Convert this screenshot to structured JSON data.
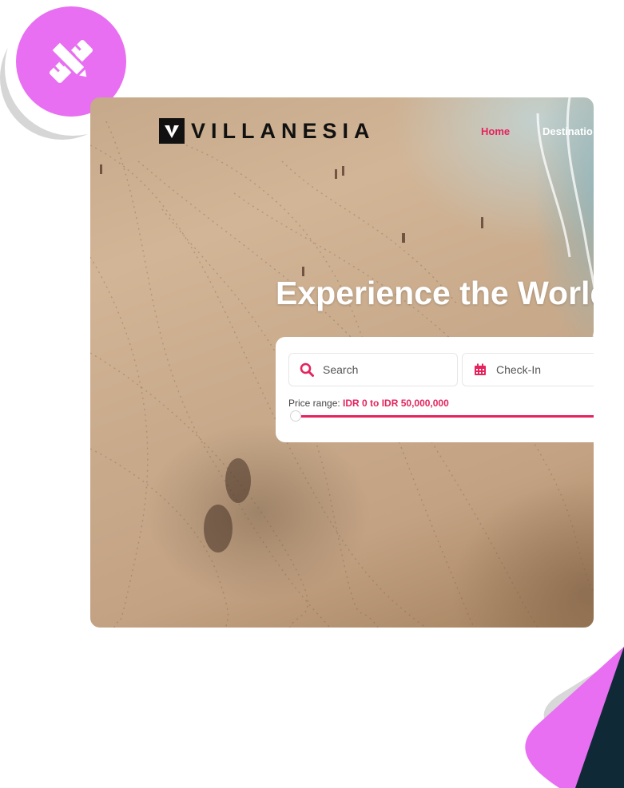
{
  "badge": {
    "icon": "pencil-ruler-icon",
    "color": "#e86ff2"
  },
  "brand": {
    "name": "VILLANESIA"
  },
  "nav": {
    "home": "Home",
    "destinations": "Destinatio"
  },
  "hero": {
    "title": "Experience the World"
  },
  "search": {
    "search_placeholder": "Search",
    "checkin_placeholder": "Check-In",
    "price_label": "Price range:",
    "price_value": "IDR 0 to IDR 50,000,000",
    "price_fraction": 1.0
  },
  "colors": {
    "accent": "#e5235d",
    "badge": "#e86ff2",
    "dark_teal": "#0f2a36"
  }
}
